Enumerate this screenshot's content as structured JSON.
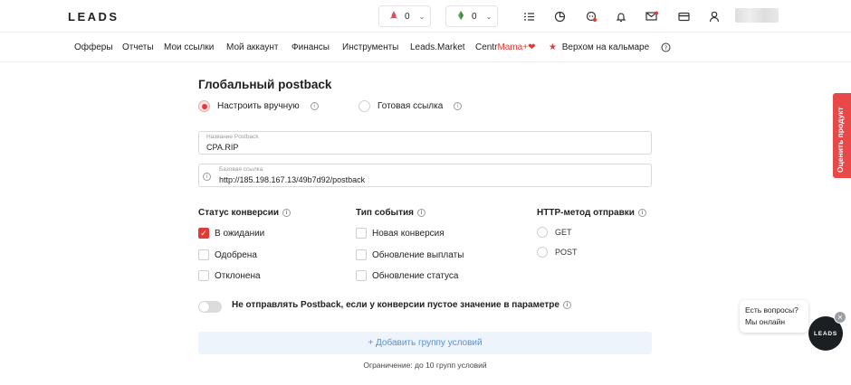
{
  "topbar": {
    "logo": "LEADS",
    "balance1": "0",
    "balance2": "0"
  },
  "nav": {
    "items": [
      "Офферы",
      "Отчеты",
      "Мои ссылки",
      "Мой аккаунт",
      "Финансы",
      "Инструменты",
      "Leads.Market"
    ],
    "centr_prefix": "Centr",
    "centr_suffix": "Mama+",
    "promo": "Верхом на кальмаре"
  },
  "page": {
    "title": "Глобальный postback",
    "mode_manual": "Настроить вручную",
    "mode_ready": "Готовая ссылка",
    "name_label": "Название Postback",
    "name_value": "CPA.RIP",
    "url_label": "Базовая ссылка",
    "url_value": "http://185.198.167.13/49b7d92/postback"
  },
  "status": {
    "header": "Статус конверсии",
    "items": [
      "В ожидании",
      "Одобрена",
      "Отклонена"
    ]
  },
  "event": {
    "header": "Тип события",
    "items": [
      "Новая конверсия",
      "Обновление выплаты",
      "Обновление статуса"
    ]
  },
  "http": {
    "header": "HTTP-метод отправки",
    "items": [
      "GET",
      "POST"
    ]
  },
  "options": {
    "toggle_label": "Не отправлять Postback, если у конверсии пустое значение в параметре",
    "add_group": "+ Добавить группу условий",
    "limit": "Ограничение: до 10 групп условий"
  },
  "widgets": {
    "rate_product": "Оценить продукт",
    "chat_line1": "Есть вопросы?",
    "chat_line2": "Мы онлайн",
    "chat_logo": "LEADS"
  },
  "colors": {
    "accent": "#e53935",
    "link": "#5b8fd6"
  }
}
